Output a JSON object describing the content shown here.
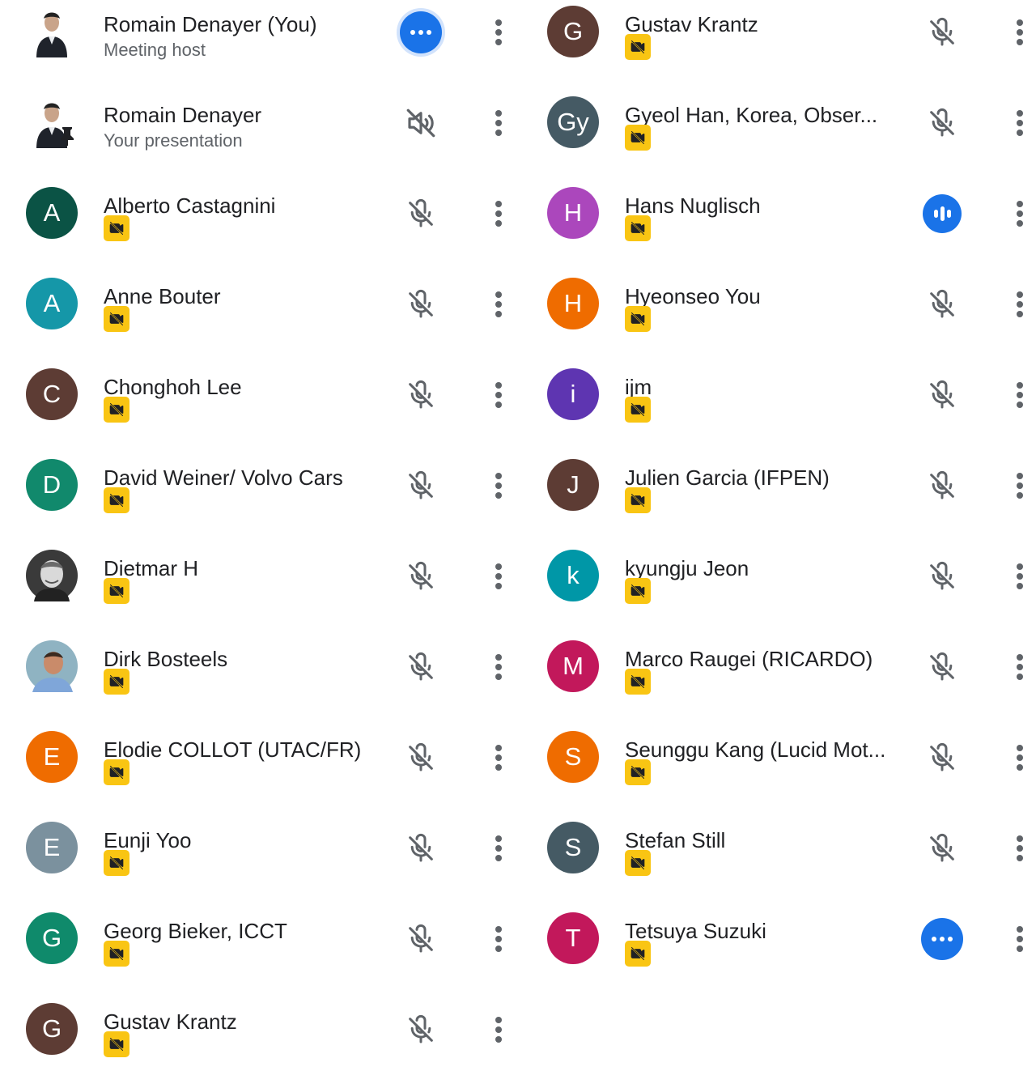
{
  "participants_left": [
    {
      "name": "Romain Denayer (You)",
      "subtitle": "Meeting host",
      "avatar_type": "photo",
      "status": "more-active",
      "host": true
    },
    {
      "name": "Romain Denayer",
      "subtitle": "Your presentation",
      "avatar_type": "photo-presentation",
      "status": "presentation-muted"
    },
    {
      "name": "Alberto Castagnini",
      "initial": "A",
      "color": "#0b5345",
      "status": "muted"
    },
    {
      "name": "Anne Bouter",
      "initial": "A",
      "color": "#1597a8",
      "status": "muted"
    },
    {
      "name": "Chonghoh Lee",
      "initial": "C",
      "color": "#5d3c34",
      "status": "muted"
    },
    {
      "name": "David Weiner/ Volvo Cars",
      "initial": "D",
      "color": "#11896c",
      "status": "muted"
    },
    {
      "name": "Dietmar H",
      "avatar_type": "photo",
      "status": "muted"
    },
    {
      "name": "Dirk Bosteels",
      "avatar_type": "photo",
      "status": "muted"
    },
    {
      "name": "Elodie COLLOT (UTAC/FR)",
      "initial": "E",
      "color": "#ef6c00",
      "status": "muted"
    },
    {
      "name": "Eunji Yoo",
      "initial": "E",
      "color": "#7b919e",
      "status": "muted"
    },
    {
      "name": "Georg Bieker, ICCT",
      "initial": "G",
      "color": "#0f8a6b",
      "status": "muted"
    },
    {
      "name": "Gustav Krantz",
      "initial": "G",
      "color": "#5d3c34",
      "status": "muted"
    }
  ],
  "participants_right": [
    {
      "name": "Gustav Krantz",
      "initial": "G",
      "color": "#5d3c34",
      "status": "muted"
    },
    {
      "name": "Gyeol Han, Korea, Obser...",
      "initial": "Gy",
      "color": "#455a64",
      "status": "muted"
    },
    {
      "name": "Hans Nuglisch",
      "initial": "H",
      "color": "#ab47bc",
      "status": "speaking"
    },
    {
      "name": "Hyeonseo You",
      "initial": "H",
      "color": "#ef6c00",
      "status": "muted"
    },
    {
      "name": "ijm",
      "initial": "i",
      "color": "#5e35b1",
      "status": "muted"
    },
    {
      "name": "Julien Garcia (IFPEN)",
      "initial": "J",
      "color": "#5d3c34",
      "status": "muted"
    },
    {
      "name": "kyungju Jeon",
      "initial": "k",
      "color": "#0097a7",
      "status": "muted"
    },
    {
      "name": "Marco Raugei (RICARDO)",
      "initial": "M",
      "color": "#c2185b",
      "status": "muted"
    },
    {
      "name": "Seunggu Kang (Lucid Mot...",
      "initial": "S",
      "color": "#ef6c00",
      "status": "muted"
    },
    {
      "name": "Stefan Still",
      "initial": "S",
      "color": "#455a64",
      "status": "muted"
    },
    {
      "name": "Tetsuya Suzuki",
      "initial": "T",
      "color": "#c2185b",
      "status": "more-active"
    }
  ],
  "colors": {
    "badge": "#f9c513",
    "accent": "#1a73e8",
    "icon_gray": "#5f6368"
  }
}
